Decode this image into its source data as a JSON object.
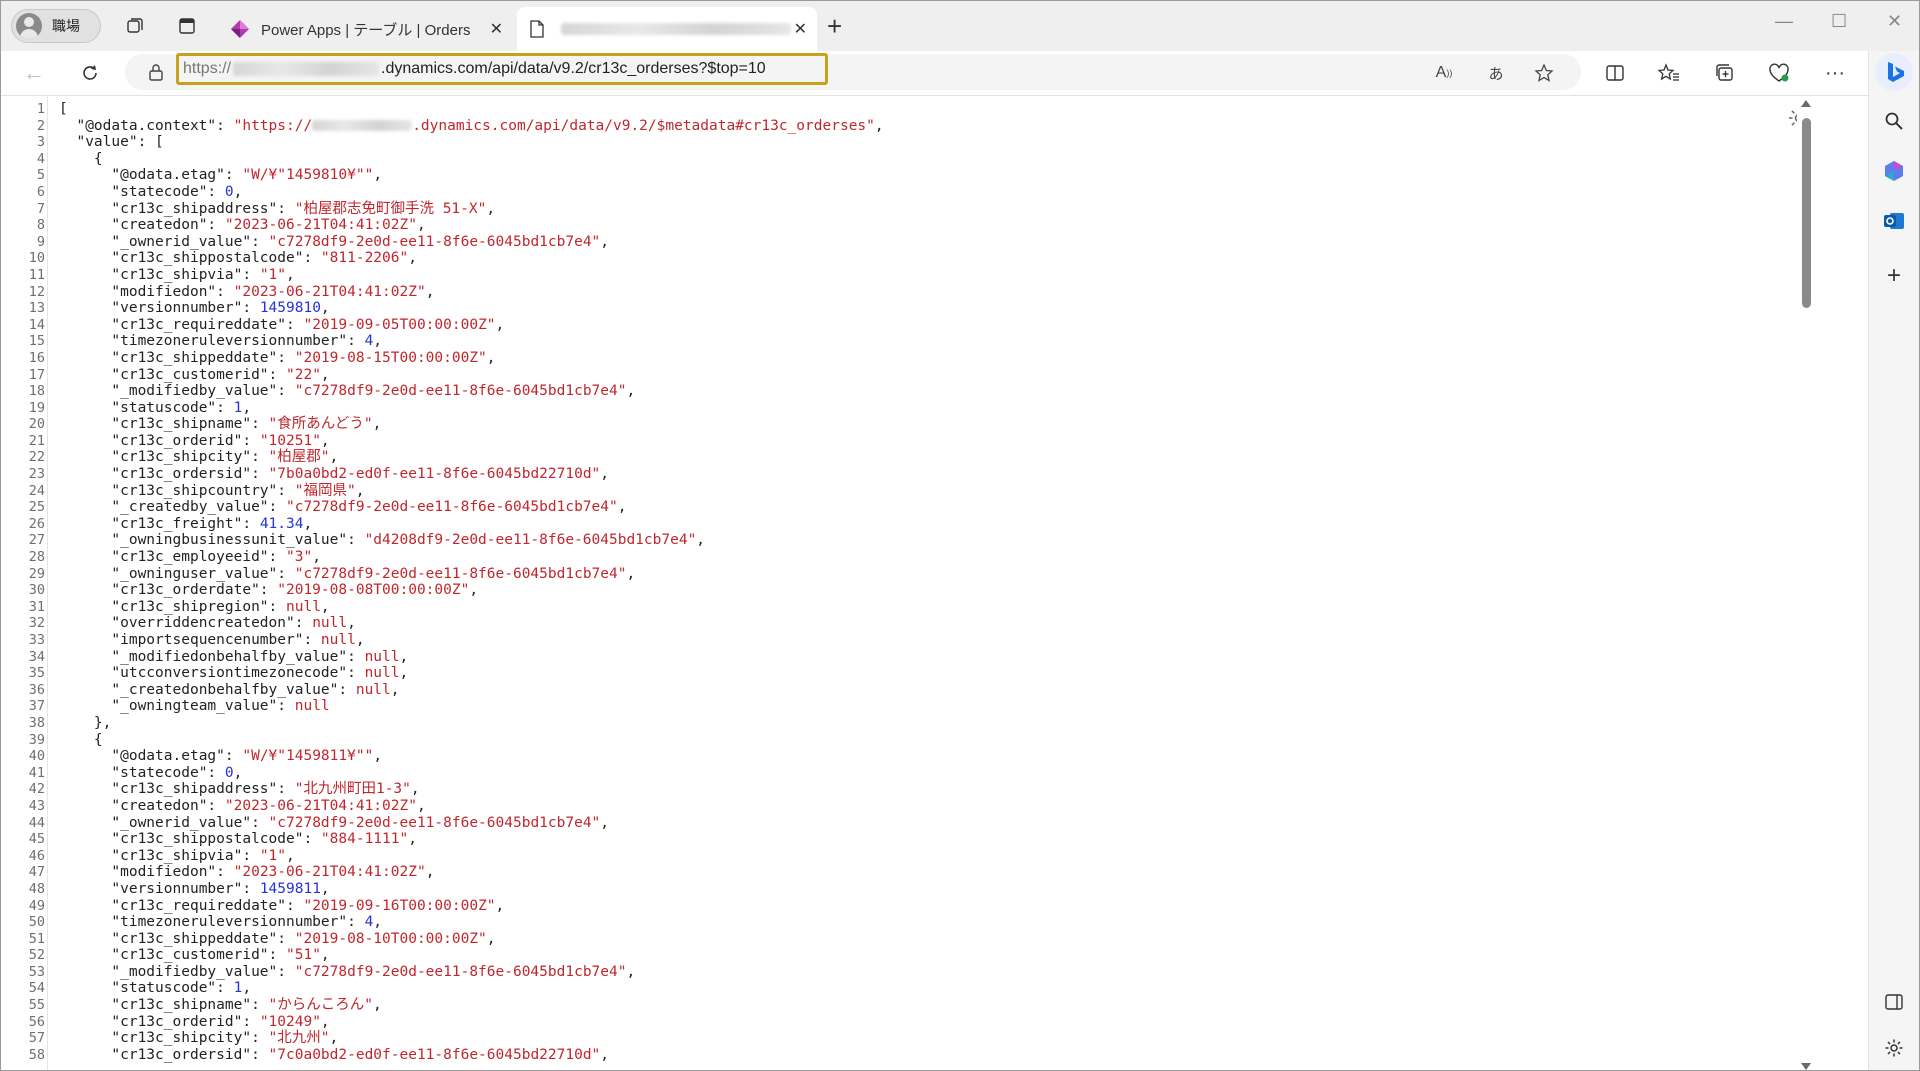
{
  "browser": {
    "profile_name": "職場",
    "tabs": [
      {
        "title": "Power Apps | テーブル | Orders",
        "active": false
      },
      {
        "title": "",
        "active": true
      }
    ],
    "address": {
      "url_visible_prefix": "https://",
      "url_visible_host_path": ".dynamics.com/api/data/v9.2/cr13c_orderses?$top=10"
    },
    "highlight_color": "#c8a11a"
  },
  "json_view": {
    "lines": [
      [
        {
          "t": "p",
          "v": "["
        }
      ],
      [
        {
          "t": "p",
          "v": "  "
        },
        {
          "t": "k",
          "v": "\"@odata.context\""
        },
        {
          "t": "p",
          "v": ": "
        },
        {
          "t": "s",
          "v": "\"https://"
        },
        {
          "t": "blur",
          "v": ""
        },
        {
          "t": "s",
          "v": ".dynamics.com/api/data/v9.2/$metadata#cr13c_orderses\""
        },
        {
          "t": "p",
          "v": ","
        }
      ],
      [
        {
          "t": "p",
          "v": "  "
        },
        {
          "t": "k",
          "v": "\"value\""
        },
        {
          "t": "p",
          "v": ": ["
        }
      ],
      [
        {
          "t": "p",
          "v": "    {"
        }
      ],
      [
        {
          "t": "p",
          "v": "      "
        },
        {
          "t": "k",
          "v": "\"@odata.etag\""
        },
        {
          "t": "p",
          "v": ": "
        },
        {
          "t": "s",
          "v": "\"W/¥\"1459810¥\"\""
        },
        {
          "t": "p",
          "v": ","
        }
      ],
      [
        {
          "t": "p",
          "v": "      "
        },
        {
          "t": "k",
          "v": "\"statecode\""
        },
        {
          "t": "p",
          "v": ": "
        },
        {
          "t": "n",
          "v": "0"
        },
        {
          "t": "p",
          "v": ","
        }
      ],
      [
        {
          "t": "p",
          "v": "      "
        },
        {
          "t": "k",
          "v": "\"cr13c_shipaddress\""
        },
        {
          "t": "p",
          "v": ": "
        },
        {
          "t": "s",
          "v": "\"柏屋郡志免町御手洗 51-X\""
        },
        {
          "t": "p",
          "v": ","
        }
      ],
      [
        {
          "t": "p",
          "v": "      "
        },
        {
          "t": "k",
          "v": "\"createdon\""
        },
        {
          "t": "p",
          "v": ": "
        },
        {
          "t": "s",
          "v": "\"2023-06-21T04:41:02Z\""
        },
        {
          "t": "p",
          "v": ","
        }
      ],
      [
        {
          "t": "p",
          "v": "      "
        },
        {
          "t": "k",
          "v": "\"_ownerid_value\""
        },
        {
          "t": "p",
          "v": ": "
        },
        {
          "t": "s",
          "v": "\"c7278df9-2e0d-ee11-8f6e-6045bd1cb7e4\""
        },
        {
          "t": "p",
          "v": ","
        }
      ],
      [
        {
          "t": "p",
          "v": "      "
        },
        {
          "t": "k",
          "v": "\"cr13c_shippostalcode\""
        },
        {
          "t": "p",
          "v": ": "
        },
        {
          "t": "s",
          "v": "\"811-2206\""
        },
        {
          "t": "p",
          "v": ","
        }
      ],
      [
        {
          "t": "p",
          "v": "      "
        },
        {
          "t": "k",
          "v": "\"cr13c_shipvia\""
        },
        {
          "t": "p",
          "v": ": "
        },
        {
          "t": "s",
          "v": "\"1\""
        },
        {
          "t": "p",
          "v": ","
        }
      ],
      [
        {
          "t": "p",
          "v": "      "
        },
        {
          "t": "k",
          "v": "\"modifiedon\""
        },
        {
          "t": "p",
          "v": ": "
        },
        {
          "t": "s",
          "v": "\"2023-06-21T04:41:02Z\""
        },
        {
          "t": "p",
          "v": ","
        }
      ],
      [
        {
          "t": "p",
          "v": "      "
        },
        {
          "t": "k",
          "v": "\"versionnumber\""
        },
        {
          "t": "p",
          "v": ": "
        },
        {
          "t": "n",
          "v": "1459810"
        },
        {
          "t": "p",
          "v": ","
        }
      ],
      [
        {
          "t": "p",
          "v": "      "
        },
        {
          "t": "k",
          "v": "\"cr13c_requireddate\""
        },
        {
          "t": "p",
          "v": ": "
        },
        {
          "t": "s",
          "v": "\"2019-09-05T00:00:00Z\""
        },
        {
          "t": "p",
          "v": ","
        }
      ],
      [
        {
          "t": "p",
          "v": "      "
        },
        {
          "t": "k",
          "v": "\"timezoneruleversionnumber\""
        },
        {
          "t": "p",
          "v": ": "
        },
        {
          "t": "n",
          "v": "4"
        },
        {
          "t": "p",
          "v": ","
        }
      ],
      [
        {
          "t": "p",
          "v": "      "
        },
        {
          "t": "k",
          "v": "\"cr13c_shippeddate\""
        },
        {
          "t": "p",
          "v": ": "
        },
        {
          "t": "s",
          "v": "\"2019-08-15T00:00:00Z\""
        },
        {
          "t": "p",
          "v": ","
        }
      ],
      [
        {
          "t": "p",
          "v": "      "
        },
        {
          "t": "k",
          "v": "\"cr13c_customerid\""
        },
        {
          "t": "p",
          "v": ": "
        },
        {
          "t": "s",
          "v": "\"22\""
        },
        {
          "t": "p",
          "v": ","
        }
      ],
      [
        {
          "t": "p",
          "v": "      "
        },
        {
          "t": "k",
          "v": "\"_modifiedby_value\""
        },
        {
          "t": "p",
          "v": ": "
        },
        {
          "t": "s",
          "v": "\"c7278df9-2e0d-ee11-8f6e-6045bd1cb7e4\""
        },
        {
          "t": "p",
          "v": ","
        }
      ],
      [
        {
          "t": "p",
          "v": "      "
        },
        {
          "t": "k",
          "v": "\"statuscode\""
        },
        {
          "t": "p",
          "v": ": "
        },
        {
          "t": "n",
          "v": "1"
        },
        {
          "t": "p",
          "v": ","
        }
      ],
      [
        {
          "t": "p",
          "v": "      "
        },
        {
          "t": "k",
          "v": "\"cr13c_shipname\""
        },
        {
          "t": "p",
          "v": ": "
        },
        {
          "t": "s",
          "v": "\"食所あんどう\""
        },
        {
          "t": "p",
          "v": ","
        }
      ],
      [
        {
          "t": "p",
          "v": "      "
        },
        {
          "t": "k",
          "v": "\"cr13c_orderid\""
        },
        {
          "t": "p",
          "v": ": "
        },
        {
          "t": "s",
          "v": "\"10251\""
        },
        {
          "t": "p",
          "v": ","
        }
      ],
      [
        {
          "t": "p",
          "v": "      "
        },
        {
          "t": "k",
          "v": "\"cr13c_shipcity\""
        },
        {
          "t": "p",
          "v": ": "
        },
        {
          "t": "s",
          "v": "\"柏屋郡\""
        },
        {
          "t": "p",
          "v": ","
        }
      ],
      [
        {
          "t": "p",
          "v": "      "
        },
        {
          "t": "k",
          "v": "\"cr13c_ordersid\""
        },
        {
          "t": "p",
          "v": ": "
        },
        {
          "t": "s",
          "v": "\"7b0a0bd2-ed0f-ee11-8f6e-6045bd22710d\""
        },
        {
          "t": "p",
          "v": ","
        }
      ],
      [
        {
          "t": "p",
          "v": "      "
        },
        {
          "t": "k",
          "v": "\"cr13c_shipcountry\""
        },
        {
          "t": "p",
          "v": ": "
        },
        {
          "t": "s",
          "v": "\"福岡県\""
        },
        {
          "t": "p",
          "v": ","
        }
      ],
      [
        {
          "t": "p",
          "v": "      "
        },
        {
          "t": "k",
          "v": "\"_createdby_value\""
        },
        {
          "t": "p",
          "v": ": "
        },
        {
          "t": "s",
          "v": "\"c7278df9-2e0d-ee11-8f6e-6045bd1cb7e4\""
        },
        {
          "t": "p",
          "v": ","
        }
      ],
      [
        {
          "t": "p",
          "v": "      "
        },
        {
          "t": "k",
          "v": "\"cr13c_freight\""
        },
        {
          "t": "p",
          "v": ": "
        },
        {
          "t": "n",
          "v": "41.34"
        },
        {
          "t": "p",
          "v": ","
        }
      ],
      [
        {
          "t": "p",
          "v": "      "
        },
        {
          "t": "k",
          "v": "\"_owningbusinessunit_value\""
        },
        {
          "t": "p",
          "v": ": "
        },
        {
          "t": "s",
          "v": "\"d4208df9-2e0d-ee11-8f6e-6045bd1cb7e4\""
        },
        {
          "t": "p",
          "v": ","
        }
      ],
      [
        {
          "t": "p",
          "v": "      "
        },
        {
          "t": "k",
          "v": "\"cr13c_employeeid\""
        },
        {
          "t": "p",
          "v": ": "
        },
        {
          "t": "s",
          "v": "\"3\""
        },
        {
          "t": "p",
          "v": ","
        }
      ],
      [
        {
          "t": "p",
          "v": "      "
        },
        {
          "t": "k",
          "v": "\"_owninguser_value\""
        },
        {
          "t": "p",
          "v": ": "
        },
        {
          "t": "s",
          "v": "\"c7278df9-2e0d-ee11-8f6e-6045bd1cb7e4\""
        },
        {
          "t": "p",
          "v": ","
        }
      ],
      [
        {
          "t": "p",
          "v": "      "
        },
        {
          "t": "k",
          "v": "\"cr13c_orderdate\""
        },
        {
          "t": "p",
          "v": ": "
        },
        {
          "t": "s",
          "v": "\"2019-08-08T00:00:00Z\""
        },
        {
          "t": "p",
          "v": ","
        }
      ],
      [
        {
          "t": "p",
          "v": "      "
        },
        {
          "t": "k",
          "v": "\"cr13c_shipregion\""
        },
        {
          "t": "p",
          "v": ": "
        },
        {
          "t": "nl",
          "v": "null"
        },
        {
          "t": "p",
          "v": ","
        }
      ],
      [
        {
          "t": "p",
          "v": "      "
        },
        {
          "t": "k",
          "v": "\"overriddencreatedon\""
        },
        {
          "t": "p",
          "v": ": "
        },
        {
          "t": "nl",
          "v": "null"
        },
        {
          "t": "p",
          "v": ","
        }
      ],
      [
        {
          "t": "p",
          "v": "      "
        },
        {
          "t": "k",
          "v": "\"importsequencenumber\""
        },
        {
          "t": "p",
          "v": ": "
        },
        {
          "t": "nl",
          "v": "null"
        },
        {
          "t": "p",
          "v": ","
        }
      ],
      [
        {
          "t": "p",
          "v": "      "
        },
        {
          "t": "k",
          "v": "\"_modifiedonbehalfby_value\""
        },
        {
          "t": "p",
          "v": ": "
        },
        {
          "t": "nl",
          "v": "null"
        },
        {
          "t": "p",
          "v": ","
        }
      ],
      [
        {
          "t": "p",
          "v": "      "
        },
        {
          "t": "k",
          "v": "\"utcconversiontimezonecode\""
        },
        {
          "t": "p",
          "v": ": "
        },
        {
          "t": "nl",
          "v": "null"
        },
        {
          "t": "p",
          "v": ","
        }
      ],
      [
        {
          "t": "p",
          "v": "      "
        },
        {
          "t": "k",
          "v": "\"_createdonbehalfby_value\""
        },
        {
          "t": "p",
          "v": ": "
        },
        {
          "t": "nl",
          "v": "null"
        },
        {
          "t": "p",
          "v": ","
        }
      ],
      [
        {
          "t": "p",
          "v": "      "
        },
        {
          "t": "k",
          "v": "\"_owningteam_value\""
        },
        {
          "t": "p",
          "v": ": "
        },
        {
          "t": "nl",
          "v": "null"
        }
      ],
      [
        {
          "t": "p",
          "v": "    },"
        }
      ],
      [
        {
          "t": "p",
          "v": "    {"
        }
      ],
      [
        {
          "t": "p",
          "v": "      "
        },
        {
          "t": "k",
          "v": "\"@odata.etag\""
        },
        {
          "t": "p",
          "v": ": "
        },
        {
          "t": "s",
          "v": "\"W/¥\"1459811¥\"\""
        },
        {
          "t": "p",
          "v": ","
        }
      ],
      [
        {
          "t": "p",
          "v": "      "
        },
        {
          "t": "k",
          "v": "\"statecode\""
        },
        {
          "t": "p",
          "v": ": "
        },
        {
          "t": "n",
          "v": "0"
        },
        {
          "t": "p",
          "v": ","
        }
      ],
      [
        {
          "t": "p",
          "v": "      "
        },
        {
          "t": "k",
          "v": "\"cr13c_shipaddress\""
        },
        {
          "t": "p",
          "v": ": "
        },
        {
          "t": "s",
          "v": "\"北九州町田1-3\""
        },
        {
          "t": "p",
          "v": ","
        }
      ],
      [
        {
          "t": "p",
          "v": "      "
        },
        {
          "t": "k",
          "v": "\"createdon\""
        },
        {
          "t": "p",
          "v": ": "
        },
        {
          "t": "s",
          "v": "\"2023-06-21T04:41:02Z\""
        },
        {
          "t": "p",
          "v": ","
        }
      ],
      [
        {
          "t": "p",
          "v": "      "
        },
        {
          "t": "k",
          "v": "\"_ownerid_value\""
        },
        {
          "t": "p",
          "v": ": "
        },
        {
          "t": "s",
          "v": "\"c7278df9-2e0d-ee11-8f6e-6045bd1cb7e4\""
        },
        {
          "t": "p",
          "v": ","
        }
      ],
      [
        {
          "t": "p",
          "v": "      "
        },
        {
          "t": "k",
          "v": "\"cr13c_shippostalcode\""
        },
        {
          "t": "p",
          "v": ": "
        },
        {
          "t": "s",
          "v": "\"884-1111\""
        },
        {
          "t": "p",
          "v": ","
        }
      ],
      [
        {
          "t": "p",
          "v": "      "
        },
        {
          "t": "k",
          "v": "\"cr13c_shipvia\""
        },
        {
          "t": "p",
          "v": ": "
        },
        {
          "t": "s",
          "v": "\"1\""
        },
        {
          "t": "p",
          "v": ","
        }
      ],
      [
        {
          "t": "p",
          "v": "      "
        },
        {
          "t": "k",
          "v": "\"modifiedon\""
        },
        {
          "t": "p",
          "v": ": "
        },
        {
          "t": "s",
          "v": "\"2023-06-21T04:41:02Z\""
        },
        {
          "t": "p",
          "v": ","
        }
      ],
      [
        {
          "t": "p",
          "v": "      "
        },
        {
          "t": "k",
          "v": "\"versionnumber\""
        },
        {
          "t": "p",
          "v": ": "
        },
        {
          "t": "n",
          "v": "1459811"
        },
        {
          "t": "p",
          "v": ","
        }
      ],
      [
        {
          "t": "p",
          "v": "      "
        },
        {
          "t": "k",
          "v": "\"cr13c_requireddate\""
        },
        {
          "t": "p",
          "v": ": "
        },
        {
          "t": "s",
          "v": "\"2019-09-16T00:00:00Z\""
        },
        {
          "t": "p",
          "v": ","
        }
      ],
      [
        {
          "t": "p",
          "v": "      "
        },
        {
          "t": "k",
          "v": "\"timezoneruleversionnumber\""
        },
        {
          "t": "p",
          "v": ": "
        },
        {
          "t": "n",
          "v": "4"
        },
        {
          "t": "p",
          "v": ","
        }
      ],
      [
        {
          "t": "p",
          "v": "      "
        },
        {
          "t": "k",
          "v": "\"cr13c_shippeddate\""
        },
        {
          "t": "p",
          "v": ": "
        },
        {
          "t": "s",
          "v": "\"2019-08-10T00:00:00Z\""
        },
        {
          "t": "p",
          "v": ","
        }
      ],
      [
        {
          "t": "p",
          "v": "      "
        },
        {
          "t": "k",
          "v": "\"cr13c_customerid\""
        },
        {
          "t": "p",
          "v": ": "
        },
        {
          "t": "s",
          "v": "\"51\""
        },
        {
          "t": "p",
          "v": ","
        }
      ],
      [
        {
          "t": "p",
          "v": "      "
        },
        {
          "t": "k",
          "v": "\"_modifiedby_value\""
        },
        {
          "t": "p",
          "v": ": "
        },
        {
          "t": "s",
          "v": "\"c7278df9-2e0d-ee11-8f6e-6045bd1cb7e4\""
        },
        {
          "t": "p",
          "v": ","
        }
      ],
      [
        {
          "t": "p",
          "v": "      "
        },
        {
          "t": "k",
          "v": "\"statuscode\""
        },
        {
          "t": "p",
          "v": ": "
        },
        {
          "t": "n",
          "v": "1"
        },
        {
          "t": "p",
          "v": ","
        }
      ],
      [
        {
          "t": "p",
          "v": "      "
        },
        {
          "t": "k",
          "v": "\"cr13c_shipname\""
        },
        {
          "t": "p",
          "v": ": "
        },
        {
          "t": "s",
          "v": "\"からんころん\""
        },
        {
          "t": "p",
          "v": ","
        }
      ],
      [
        {
          "t": "p",
          "v": "      "
        },
        {
          "t": "k",
          "v": "\"cr13c_orderid\""
        },
        {
          "t": "p",
          "v": ": "
        },
        {
          "t": "s",
          "v": "\"10249\""
        },
        {
          "t": "p",
          "v": ","
        }
      ],
      [
        {
          "t": "p",
          "v": "      "
        },
        {
          "t": "k",
          "v": "\"cr13c_shipcity\""
        },
        {
          "t": "p",
          "v": ": "
        },
        {
          "t": "s",
          "v": "\"北九州\""
        },
        {
          "t": "p",
          "v": ","
        }
      ],
      [
        {
          "t": "p",
          "v": "      "
        },
        {
          "t": "k",
          "v": "\"cr13c_ordersid\""
        },
        {
          "t": "p",
          "v": ": "
        },
        {
          "t": "s",
          "v": "\"7c0a0bd2-ed0f-ee11-8f6e-6045bd22710d\""
        },
        {
          "t": "p",
          "v": ","
        }
      ]
    ]
  }
}
